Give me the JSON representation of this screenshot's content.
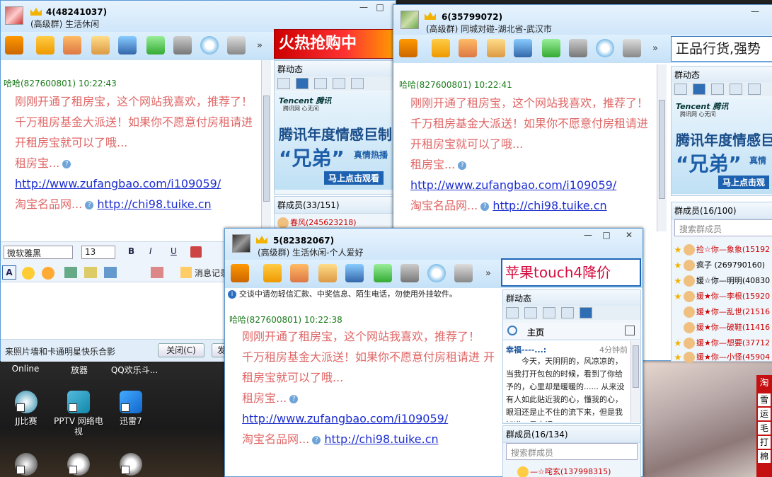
{
  "win4": {
    "group_title": "4(48241037)",
    "subtitle": "(高级群) 生活休闲",
    "message": {
      "sender": "哈哈(827600801)",
      "time": "10:22:43",
      "lines": [
        "刚刚开通了租房宝，这个网站我喜欢，推荐了！",
        "千万租房基金大派送！如果你不愿意付房租请进 开租房宝就可以了哦...",
        "租房宝..."
      ],
      "link1": "http://www.zufangbao.com/i109059/",
      "line_shop": "淘宝名品网...",
      "link2": "http://chi98.tuike.cn"
    },
    "ad_text": "火热抢购中",
    "panel_title": "群动态",
    "banner": {
      "brand": "Tencent 腾讯",
      "brand_sub": "腾讯网 心无间",
      "headline": "腾讯年度情感巨制",
      "big": "“兄弟”",
      "tagline": "真情热播",
      "cta": "马上点击观看"
    },
    "members_label": "群成员(33/151)",
    "member_first": "春风(245623218)",
    "font_name": "微软雅黑",
    "font_size": "13",
    "msg_history": "消息记录",
    "bottom_note": "来照片墙和卡通明星快乐合影",
    "close_btn": "关闭(C)",
    "send_btn": "发"
  },
  "win6": {
    "group_title": "6(35799072)",
    "subtitle": "(高级群) 同城对碰-湖北省-武汉市",
    "message": {
      "sender": "哈哈(827600801)",
      "time": "10:22:41",
      "lines": [
        "刚刚开通了租房宝，这个网站我喜欢，推荐了！",
        "千万租房基金大派送！如果你不愿意付房租请进 开租房宝就可以了哦...",
        "租房宝..."
      ],
      "link1": "http://www.zufangbao.com/i109059/",
      "line_shop": "淘宝名品网...",
      "link2": "http://chi98.tuike.cn"
    },
    "ad_text": "正品行货,强势",
    "panel_title": "群动态",
    "banner": {
      "brand": "Tencent 腾讯",
      "brand_sub": "腾讯网 心无间",
      "headline": "腾讯年度情感巨",
      "big": "“兄弟”",
      "tagline": "真情",
      "cta": "马上点击观"
    },
    "members_label": "群成员(16/100)",
    "search_placeholder": "搜索群成员",
    "members": [
      {
        "name": "捡☆你—象象",
        "num": "(15192"
      },
      {
        "name": "疯子",
        "num": "(269790160)"
      },
      {
        "name": "媛☆你—明明",
        "num": "(40830"
      },
      {
        "name": "媛★你—李根",
        "num": "(15920"
      },
      {
        "name": "媛★你—乱世",
        "num": "(21516"
      },
      {
        "name": "媛★你—破鞋",
        "num": "(11416"
      },
      {
        "name": "媛★你—想要",
        "num": "(37712"
      },
      {
        "name": "媛★你—小怪",
        "num": "(45904"
      }
    ]
  },
  "win5": {
    "group_title": "5(82382067)",
    "subtitle": "(高级群) 生活休闲-个人爱好",
    "notice": "交谈中请勿轻信汇款、中奖信息、陌生电话，勿使用外挂软件。",
    "message": {
      "sender": "哈哈(827600801)",
      "time": "10:22:38",
      "lines": [
        "刚刚开通了租房宝，这个网站我喜欢，推荐了！",
        "千万租房基金大派送！如果你不愿意付房租请进 开租房宝就可以了哦...",
        "租房宝..."
      ],
      "link1": "http://www.zufangbao.com/i109059/",
      "line_shop": "淘宝名品网...",
      "link2": "http://chi98.tuike.cn"
    },
    "ad_text": "苹果touch4降价",
    "panel_title": "群动态",
    "home_label": "主页",
    "post": {
      "author": "幸福----...:",
      "time": "4分钟前",
      "text": "今天，天阴阴的，风凉凉的，当我打开包包的时候，看到了你给予的，心里却是暖暖的...... 从来没有人如此贴近我的心，懂我的心，眼泪还是止不住的流下来，但是我知道，是幸福"
    },
    "members_label": "群成员(16/134)",
    "search_placeholder": "搜索群成员",
    "member_first": "—☆咤玄(137998315)"
  },
  "desktop": {
    "row1": [
      "Online",
      "放器",
      "QQ欢乐斗..."
    ],
    "icons": [
      {
        "label": "JJ比赛"
      },
      {
        "label": "PPTV 网络电视"
      },
      {
        "label": "迅雷7"
      }
    ]
  },
  "wallpaper_menu": [
    "淘",
    "雪",
    "运",
    "毛",
    "打",
    "棉"
  ],
  "controls": {
    "min": "—",
    "max": "□",
    "close": "✕"
  }
}
